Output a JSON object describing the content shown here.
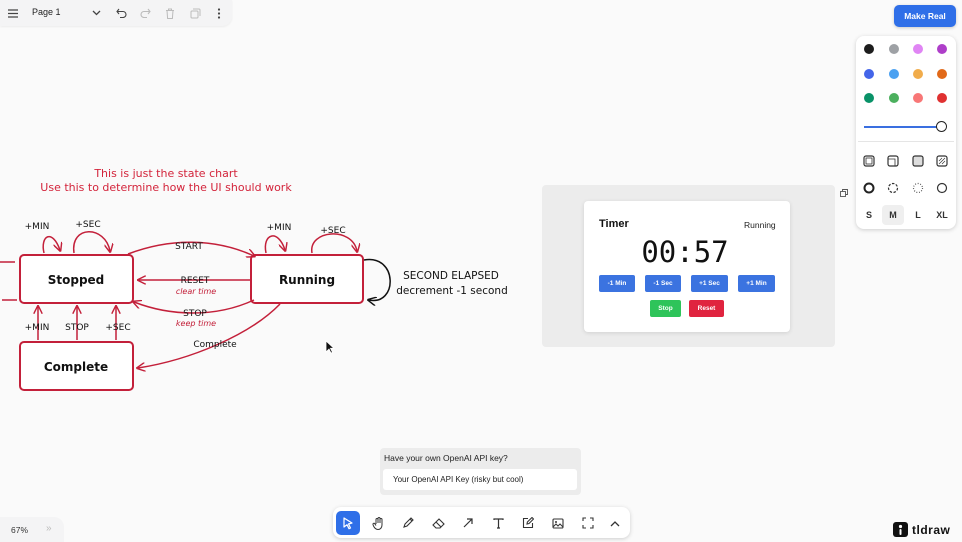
{
  "topbar": {
    "page_name": "Page 1",
    "icons": [
      "menu-icon",
      "chevron-down-icon",
      "undo-icon",
      "redo-icon",
      "trash-icon",
      "duplicate-icon",
      "more-icon"
    ]
  },
  "make_real_label": "Make Real",
  "style_panel": {
    "colors": [
      "#1d1d1d",
      "#9ea1a5",
      "#e085f4",
      "#ae3ec9",
      "#4465e9",
      "#4ba1f1",
      "#f1ac4b",
      "#e16919",
      "#099268",
      "#4cb05e",
      "#f87777",
      "#e03131"
    ],
    "opacity": 1.0,
    "sizes": [
      "S",
      "M",
      "L",
      "XL"
    ],
    "selected_size": "M"
  },
  "diagram": {
    "note_line1": "This is just the state chart",
    "note_line2": "Use this to determine how the UI should work",
    "states": {
      "stopped": "Stopped",
      "running": "Running",
      "complete": "Complete"
    },
    "labels": {
      "min": "+MIN",
      "sec": "+SEC",
      "start": "START",
      "reset": "RESET",
      "clear_time": "clear time",
      "stop": "STOP",
      "keep_time": "keep time",
      "complete": "Complete",
      "stop_upper": "STOP",
      "second_elapsed": "SECOND ELAPSED",
      "decrement": "decrement -1 second"
    }
  },
  "timer_card": {
    "title": "Timer",
    "status": "Running",
    "time": "00:57",
    "buttons": {
      "minus_min": "-1 Min",
      "minus_sec": "-1 Sec",
      "plus_sec": "+1 Sec",
      "plus_min": "+1 Min",
      "stop": "Stop",
      "reset": "Reset"
    }
  },
  "api": {
    "label": "Have your own OpenAI API key?",
    "placeholder": "Your OpenAI API Key (risky but cool)"
  },
  "toolbar": {
    "tools": [
      "select-icon",
      "hand-icon",
      "pencil-icon",
      "eraser-icon",
      "arrow-icon",
      "text-icon",
      "note-icon",
      "image-icon",
      "frame-icon",
      "chevron-up-icon"
    ],
    "selected": "select-icon"
  },
  "zoom": "67%",
  "logo_text": "tldraw"
}
